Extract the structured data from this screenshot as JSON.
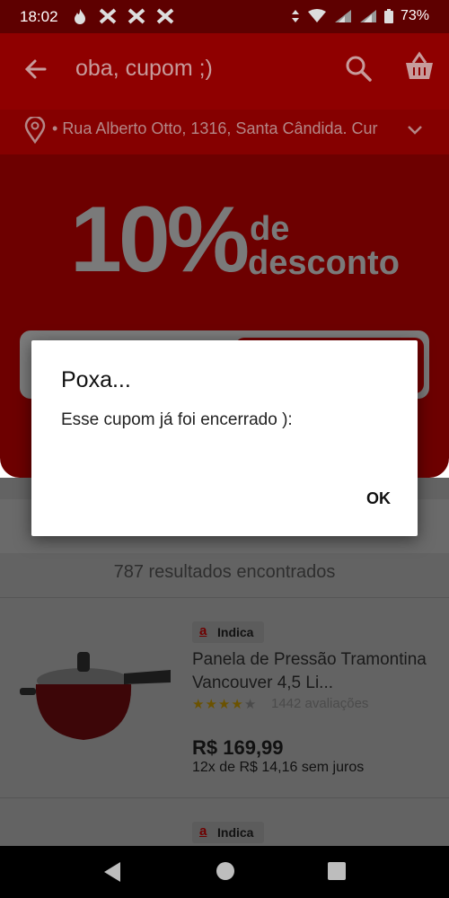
{
  "status_bar": {
    "time": "18:02",
    "battery": "73%"
  },
  "app_bar": {
    "title": "oba, cupom ;)"
  },
  "address": {
    "text": "Rua Alberto Otto, 1316, Santa Cândida. Cur"
  },
  "banner": {
    "percent": "10%",
    "line1": "de",
    "line2": "desconto"
  },
  "results": {
    "text": "787 resultados encontrados"
  },
  "products": [
    {
      "tag": "Indica",
      "name": "Panela de Pressão Tramontina Vancouver 4,5 Li...",
      "stars": "★★★★★",
      "rating": 4,
      "reviews": "1442 avaliações",
      "price": "R$ 169,99",
      "installments": "12x de R$ 14,16 sem juros"
    },
    {
      "tag": "Indica"
    }
  ],
  "dialog": {
    "title": "Poxa...",
    "message": "Esse cupom já foi encerrado ):",
    "ok_label": "OK"
  },
  "colors": {
    "brand": "#cc0000",
    "dialog_bg": "#ffffff",
    "overlay_dim": "#000000"
  }
}
